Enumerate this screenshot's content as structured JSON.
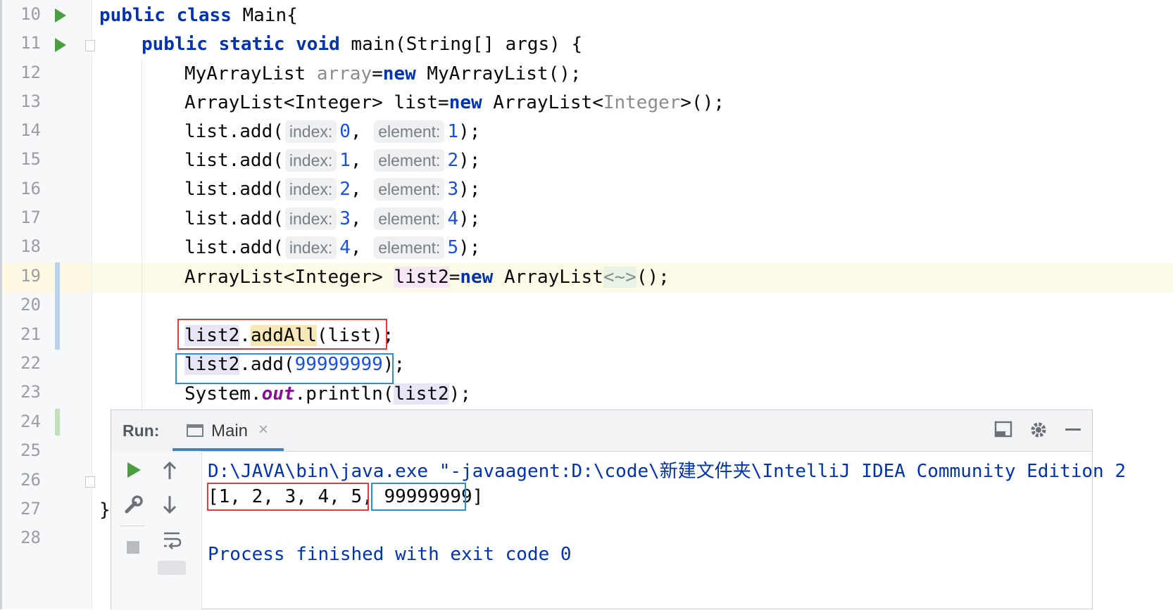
{
  "editor": {
    "line_numbers": [
      "10",
      "11",
      "12",
      "13",
      "14",
      "15",
      "16",
      "17",
      "18",
      "19",
      "20",
      "21",
      "22",
      "23",
      "24",
      "25",
      "26",
      "27",
      "28"
    ],
    "code": {
      "l10": {
        "kw": "public class ",
        "rest": "Main{"
      },
      "l11": {
        "kw": "public static void ",
        "rest": "main(String[] args) {"
      },
      "l12": {
        "type": "MyArrayList ",
        "var": "array",
        "eq": "=",
        "kw": "new",
        "rest": " MyArrayList();"
      },
      "l13": {
        "type": "ArrayList<Integer> list=",
        "kw": "new",
        "rest1": " ArrayList<",
        "generic": "Integer",
        "rest2": ">();"
      },
      "adds": [
        {
          "pre": "list.add(",
          "hint_index": "index:",
          "index": "0",
          "comma": ",",
          "hint_element": "element:",
          "element": "1",
          "post": ");"
        },
        {
          "pre": "list.add(",
          "hint_index": "index:",
          "index": "1",
          "comma": ",",
          "hint_element": "element:",
          "element": "2",
          "post": ");"
        },
        {
          "pre": "list.add(",
          "hint_index": "index:",
          "index": "2",
          "comma": ",",
          "hint_element": "element:",
          "element": "3",
          "post": ");"
        },
        {
          "pre": "list.add(",
          "hint_index": "index:",
          "index": "3",
          "comma": ",",
          "hint_element": "element:",
          "element": "4",
          "post": ");"
        },
        {
          "pre": "list.add(",
          "hint_index": "index:",
          "index": "4",
          "comma": ",",
          "hint_element": "element:",
          "element": "5",
          "post": ");"
        }
      ],
      "l19": {
        "type": "ArrayList<Integer> ",
        "var": "list2",
        "eq": "=",
        "kw": "new",
        "rest": " ArrayList",
        "diamond": "<~>",
        "end": "();"
      },
      "l21": {
        "var": "list2",
        "dot": ".",
        "method": "addAll",
        "rest": "(list);"
      },
      "l22": {
        "var": "list2",
        "rest": ".add(",
        "num": "99999999",
        "end": ");"
      },
      "l23": {
        "pre": "System.",
        "field": "out",
        "mid": ".println(",
        "var": "list2",
        "end": ");"
      },
      "l27": {
        "text": "}"
      }
    }
  },
  "run_panel": {
    "label": "Run:",
    "tab_label": "Main",
    "tab_close": "×",
    "icons": {
      "layout": "layout-icon",
      "settings": "gear-icon",
      "minimize": "minimize-icon",
      "rerun": "play-icon",
      "up": "up-arrow-icon",
      "wrench": "wrench-icon",
      "down": "down-arrow-icon",
      "stop": "stop-icon",
      "softwrap": "soft-wrap-icon"
    },
    "console": {
      "command": "D:\\JAVA\\bin\\java.exe \"-javaagent:D:\\code\\新建文件夹\\IntelliJ IDEA Community Edition 2",
      "output_part1": "[1, 2, 3, 4, 5,",
      "output_part2": " 99999999",
      "output_end": "]",
      "exit": "Process finished with exit code 0"
    }
  },
  "colors": {
    "keyword": "#0033b3",
    "number": "#1750eb",
    "run_green": "#4a9e3f",
    "annotation_red": "#e23b3b",
    "annotation_blue": "#2a8fd6"
  }
}
